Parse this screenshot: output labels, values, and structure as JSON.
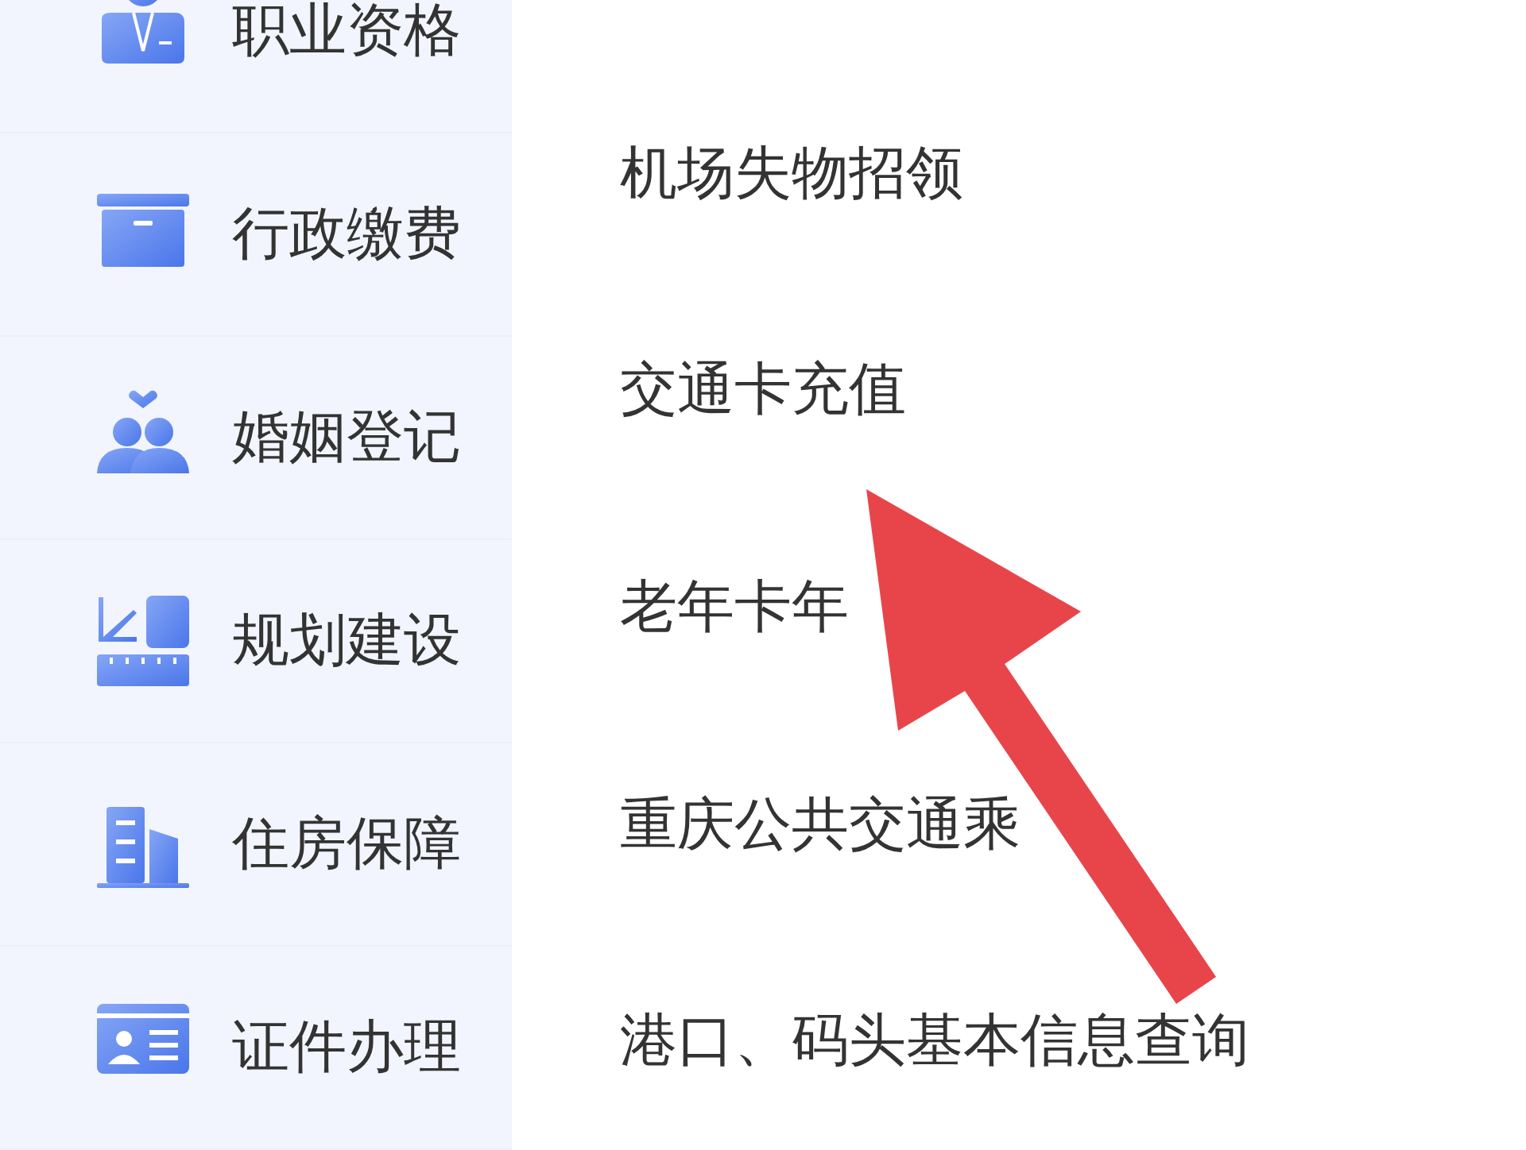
{
  "sidebar": {
    "items": [
      {
        "label": "职业资格",
        "selected": false
      },
      {
        "label": "行政缴费",
        "selected": false
      },
      {
        "label": "婚姻登记",
        "selected": false
      },
      {
        "label": "规划建设",
        "selected": false
      },
      {
        "label": "住房保障",
        "selected": false
      },
      {
        "label": "证件办理",
        "selected": false
      }
    ]
  },
  "services": [
    {
      "label": "机场失物招领"
    },
    {
      "label": "交通卡充值"
    },
    {
      "label": "老年卡年"
    },
    {
      "label": "重庆公共交通乘"
    },
    {
      "label": "港口、码头基本信息查询"
    }
  ]
}
